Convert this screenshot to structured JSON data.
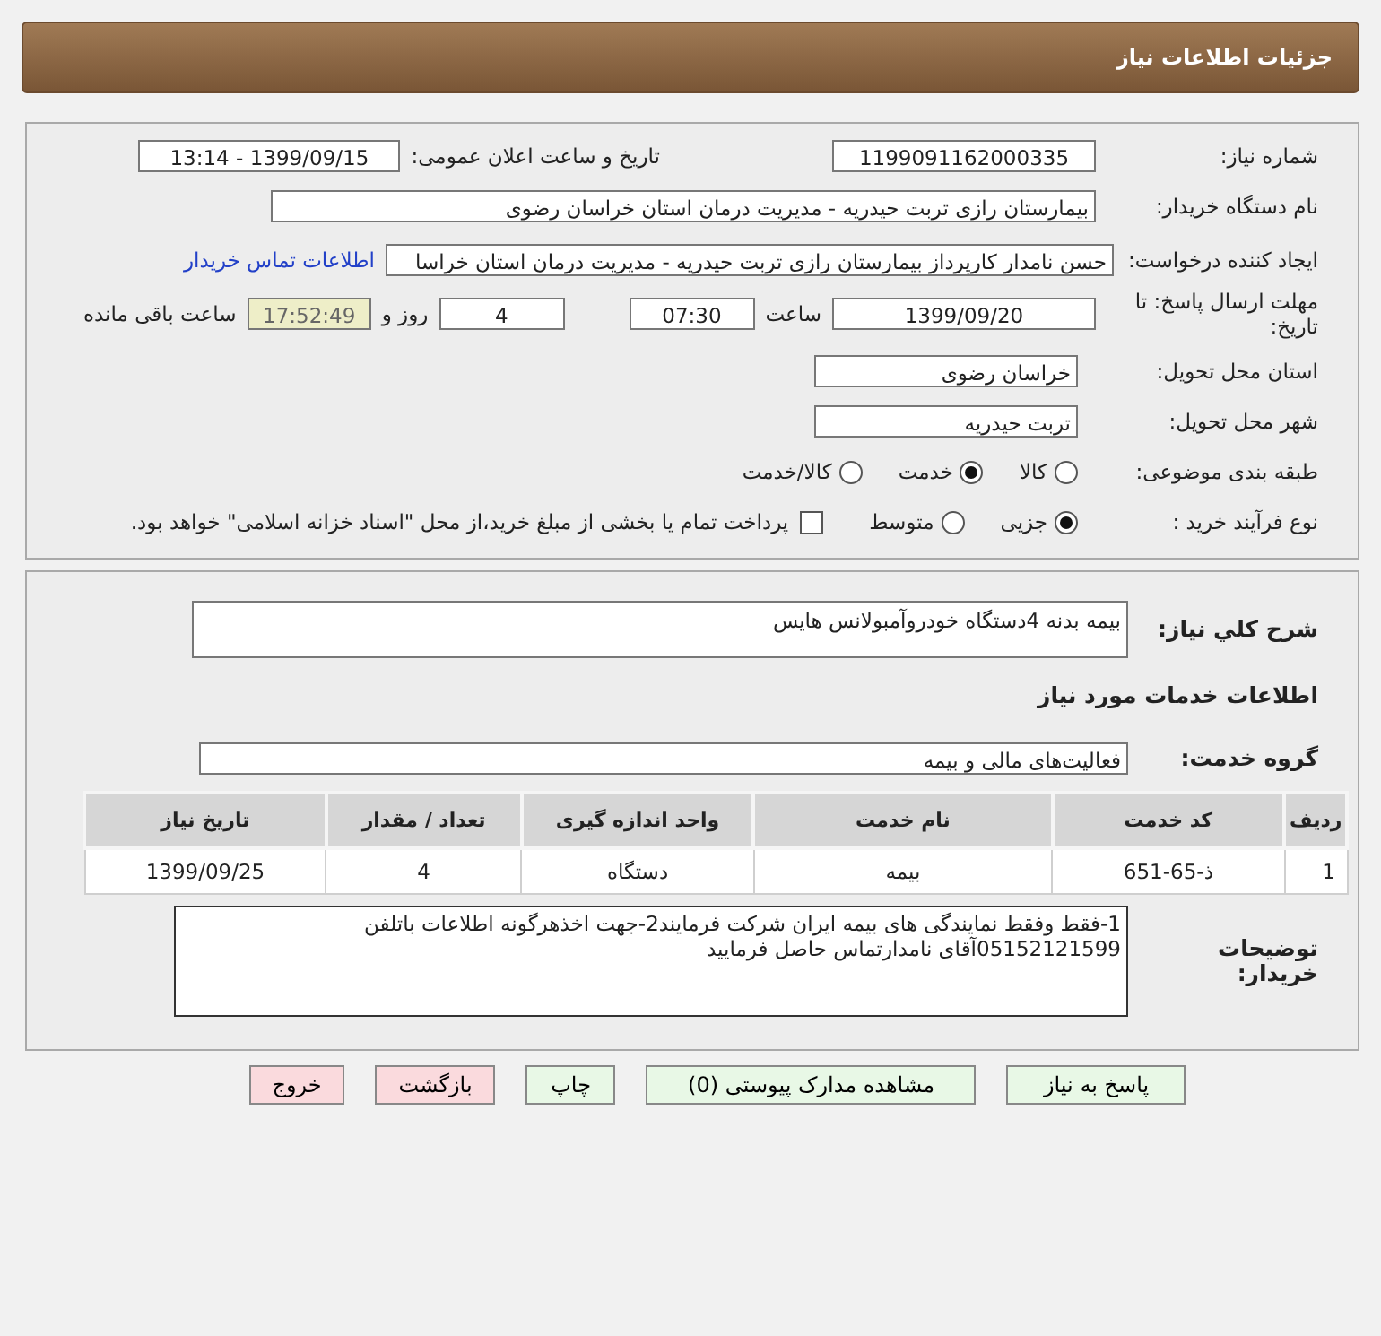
{
  "header": {
    "title": "جزئیات اطلاعات نیاز"
  },
  "need_number": {
    "label": "شماره نیاز:",
    "value": "1199091162000335"
  },
  "announce": {
    "label": "تاریخ و ساعت اعلان عمومی:",
    "value": "1399/09/15 - 13:14"
  },
  "buyer": {
    "label": "نام دستگاه خریدار:",
    "value": "بیمارستان رازی تربت حیدریه - مدیریت درمان استان خراسان رضوی"
  },
  "creator": {
    "label": "ایجاد کننده درخواست:",
    "value": "حسن نامدار کارپرداز بیمارستان رازی تربت حیدریه - مدیریت درمان استان خراسا",
    "link": "اطلاعات تماس خریدار"
  },
  "deadline": {
    "label": "مهلت ارسال پاسخ: تا تاریخ:",
    "date": "1399/09/20",
    "time_label": "ساعت",
    "time": "07:30",
    "days": "4",
    "days_label": "روز و",
    "remaining": "17:52:49",
    "remaining_label": "ساعت باقی مانده"
  },
  "province": {
    "label": "استان محل تحویل:",
    "value": "خراسان رضوی"
  },
  "city": {
    "label": "شهر محل تحویل:",
    "value": "تربت حیدریه"
  },
  "category": {
    "label": "طبقه بندی موضوعی:",
    "options": [
      {
        "label": "کالا",
        "selected": false
      },
      {
        "label": "خدمت",
        "selected": true
      },
      {
        "label": "کالا/خدمت",
        "selected": false
      }
    ]
  },
  "process": {
    "label": "نوع فرآیند خرید :",
    "options": [
      {
        "label": "جزیی",
        "selected": true
      },
      {
        "label": "متوسط",
        "selected": false
      }
    ],
    "payment": {
      "label": "پرداخت تمام یا بخشی از مبلغ خرید،از محل \"اسناد خزانه اسلامی\" خواهد بود.",
      "checked": false
    }
  },
  "description": {
    "label": "شرح کلي نياز:",
    "value": "بیمه بدنه 4دستگاه خودروآمبولانس هایس"
  },
  "services_heading": "اطلاعات خدمات مورد نیاز",
  "service_group": {
    "label": "گروه خدمت:",
    "value": "فعالیت‌های مالی و بیمه"
  },
  "table": {
    "columns": [
      "ردیف",
      "کد خدمت",
      "نام خدمت",
      "واحد اندازه گیری",
      "تعداد / مقدار",
      "تاریخ نیاز"
    ],
    "rows": [
      [
        "1",
        "ذ-65-651",
        "بیمه",
        "دستگاه",
        "4",
        "1399/09/25"
      ]
    ]
  },
  "buyer_notes": {
    "label": "توضیحات خریدار:",
    "value": "1-فقط وفقط نمایندگی های بیمه ایران  شرکت فرمایند2-جهت اخذهرگونه اطلاعات باتلفن 05152121599آقای نامدارتماس حاصل فرمایید"
  },
  "buttons": [
    {
      "label": "پاسخ به نیاز",
      "kind": "normal"
    },
    {
      "label": "مشاهده مدارک پیوستی (0)",
      "kind": "normal"
    },
    {
      "label": "چاپ",
      "kind": "normal"
    },
    {
      "label": "بازگشت",
      "kind": "danger"
    },
    {
      "label": "خروج",
      "kind": "danger"
    }
  ]
}
